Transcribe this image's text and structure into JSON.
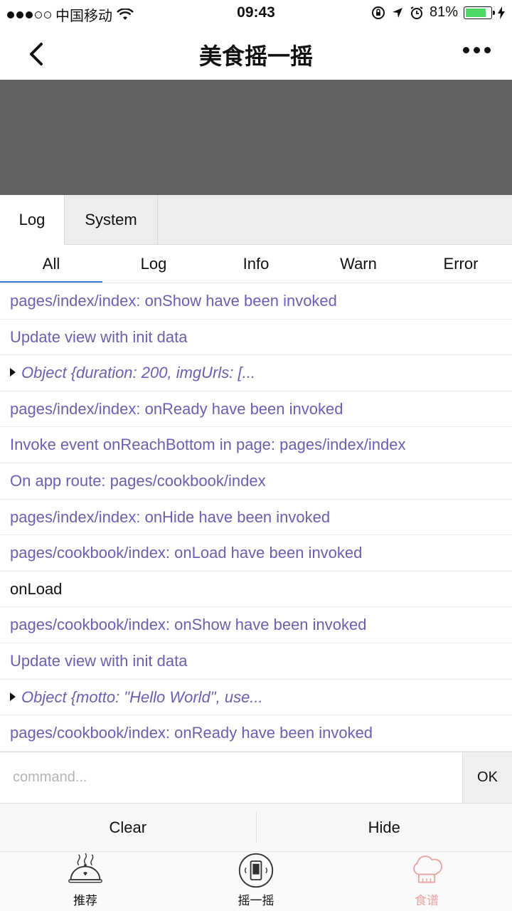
{
  "status_bar": {
    "carrier": "中国移动",
    "time": "09:43",
    "battery_percent": "81%",
    "battery_level": 0.81,
    "icons": [
      "signal-dots-icon",
      "wifi-icon",
      "rotation-lock-icon",
      "location-icon",
      "alarm-icon",
      "battery-icon",
      "charging-icon"
    ]
  },
  "nav": {
    "title": "美食摇一摇"
  },
  "console": {
    "main_tabs": [
      {
        "label": "Log",
        "active": true
      },
      {
        "label": "System",
        "active": false
      }
    ],
    "sub_tabs": [
      {
        "label": "All",
        "active": true
      },
      {
        "label": "Log"
      },
      {
        "label": "Info"
      },
      {
        "label": "Warn"
      },
      {
        "label": "Error"
      }
    ],
    "logs": [
      {
        "text": "pages/index/index: onShow have been invoked",
        "kind": "info"
      },
      {
        "text": "Update view with init data",
        "kind": "info"
      },
      {
        "text": "Object {duration: 200, imgUrls: [...",
        "kind": "object"
      },
      {
        "text": "pages/index/index: onReady have been invoked",
        "kind": "info"
      },
      {
        "text": "Invoke event onReachBottom in page: pages/index/index",
        "kind": "info"
      },
      {
        "text": "On app route: pages/cookbook/index",
        "kind": "info"
      },
      {
        "text": "pages/index/index: onHide have been invoked",
        "kind": "info"
      },
      {
        "text": "pages/cookbook/index: onLoad have been invoked",
        "kind": "info"
      },
      {
        "text": "onLoad",
        "kind": "plain"
      },
      {
        "text": "pages/cookbook/index: onShow have been invoked",
        "kind": "info"
      },
      {
        "text": "Update view with init data",
        "kind": "info"
      },
      {
        "text": "Object {motto: \"Hello World\", use...",
        "kind": "object"
      },
      {
        "text": "pages/cookbook/index: onReady have been invoked",
        "kind": "info"
      }
    ],
    "command_placeholder": "command...",
    "ok_label": "OK",
    "clear_label": "Clear",
    "hide_label": "Hide"
  },
  "tabbar": {
    "items": [
      {
        "label": "推荐",
        "icon": "dish-cloche-icon",
        "active": false
      },
      {
        "label": "摇一摇",
        "icon": "shake-phone-icon",
        "active": false
      },
      {
        "label": "食谱",
        "icon": "chef-hat-icon",
        "active": true
      }
    ]
  },
  "colors": {
    "log_text": "#6a5fb0",
    "active_tab_label": "#e8a3a3",
    "header_gray": "#636363"
  }
}
